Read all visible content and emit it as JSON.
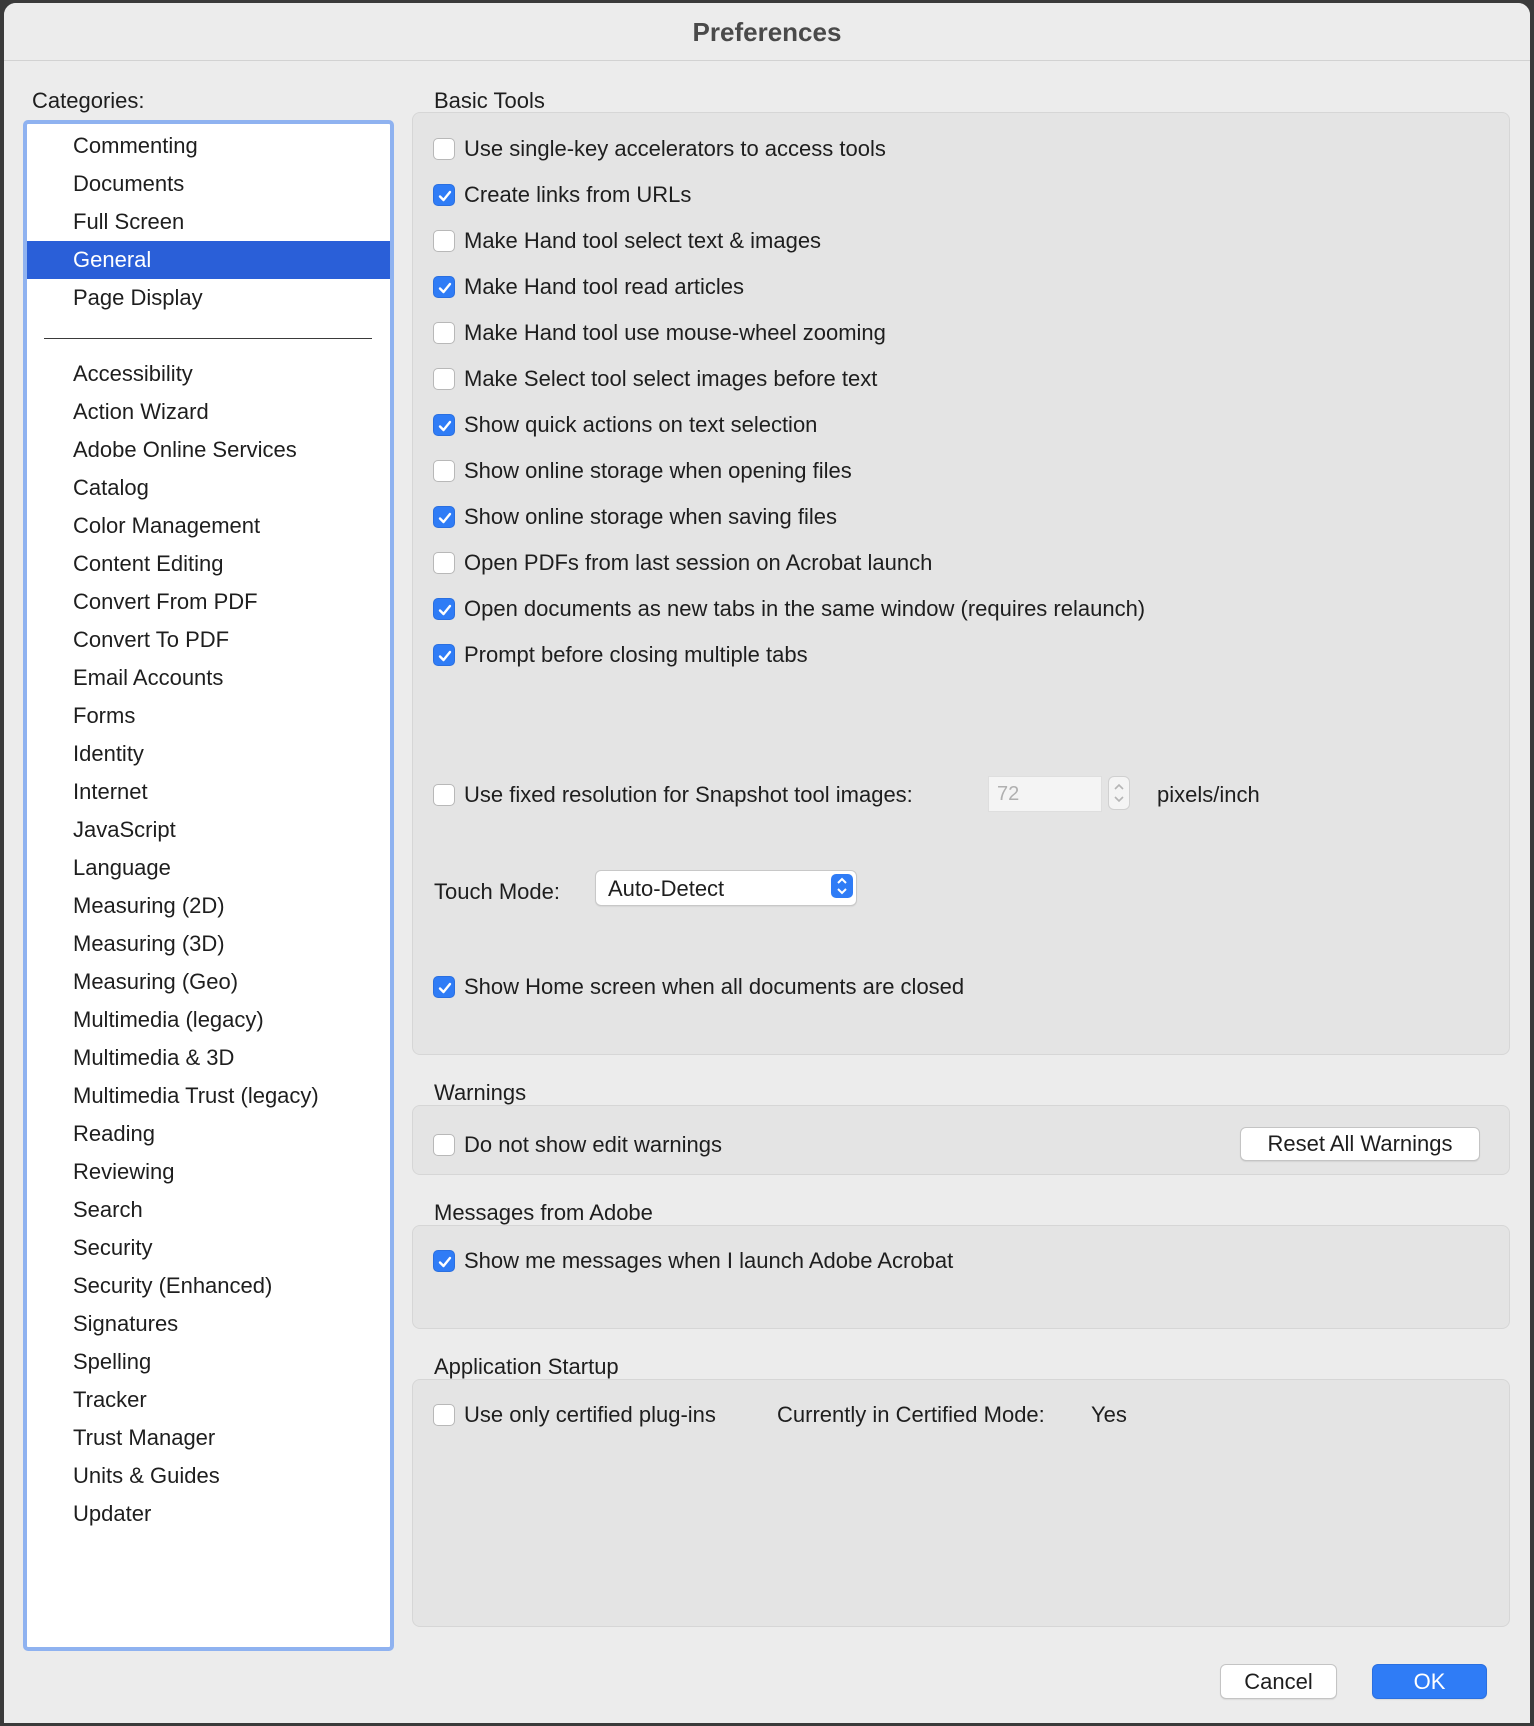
{
  "window": {
    "title": "Preferences"
  },
  "categories": {
    "label": "Categories:",
    "top_items": [
      "Commenting",
      "Documents",
      "Full Screen",
      "General",
      "Page Display"
    ],
    "selected": "General",
    "items": [
      "Accessibility",
      "Action Wizard",
      "Adobe Online Services",
      "Catalog",
      "Color Management",
      "Content Editing",
      "Convert From PDF",
      "Convert To PDF",
      "Email Accounts",
      "Forms",
      "Identity",
      "Internet",
      "JavaScript",
      "Language",
      "Measuring (2D)",
      "Measuring (3D)",
      "Measuring (Geo)",
      "Multimedia (legacy)",
      "Multimedia & 3D",
      "Multimedia Trust (legacy)",
      "Reading",
      "Reviewing",
      "Search",
      "Security",
      "Security (Enhanced)",
      "Signatures",
      "Spelling",
      "Tracker",
      "Trust Manager",
      "Units & Guides",
      "Updater"
    ]
  },
  "basic_tools": {
    "heading": "Basic Tools",
    "options": [
      {
        "label": "Use single-key accelerators to access tools",
        "checked": false
      },
      {
        "label": "Create links from URLs",
        "checked": true
      },
      {
        "label": "Make Hand tool select text & images",
        "checked": false
      },
      {
        "label": "Make Hand tool read articles",
        "checked": true
      },
      {
        "label": "Make Hand tool use mouse-wheel zooming",
        "checked": false
      },
      {
        "label": "Make Select tool select images before text",
        "checked": false
      },
      {
        "label": "Show quick actions on text selection",
        "checked": true
      },
      {
        "label": "Show online storage when opening files",
        "checked": false
      },
      {
        "label": "Show online storage when saving files",
        "checked": true
      },
      {
        "label": "Open PDFs from last session on Acrobat launch",
        "checked": false
      },
      {
        "label": "Open documents as new tabs in the same window (requires relaunch)",
        "checked": true
      },
      {
        "label": "Prompt before closing multiple tabs",
        "checked": true
      }
    ],
    "snapshot": {
      "label": "Use fixed resolution for Snapshot tool images:",
      "checked": false,
      "value": "72",
      "unit": "pixels/inch"
    },
    "touch_mode": {
      "label": "Touch Mode:",
      "value": "Auto-Detect"
    },
    "home_screen": {
      "label": "Show Home screen when all documents are closed",
      "checked": true
    }
  },
  "warnings": {
    "heading": "Warnings",
    "option": {
      "label": "Do not show edit warnings",
      "checked": false
    },
    "reset_button": "Reset All Warnings"
  },
  "messages": {
    "heading": "Messages from Adobe",
    "option": {
      "label": "Show me messages when I launch Adobe Acrobat",
      "checked": true
    }
  },
  "startup": {
    "heading": "Application Startup",
    "option": {
      "label": "Use only certified plug-ins",
      "checked": false
    },
    "certified_mode_label": "Currently in Certified Mode:",
    "certified_mode_value": "Yes"
  },
  "footer": {
    "cancel": "Cancel",
    "ok": "OK"
  },
  "colors": {
    "accent": "#2f7cf6",
    "selection": "#2a5fd8",
    "list_border": "#8fb2f0"
  }
}
